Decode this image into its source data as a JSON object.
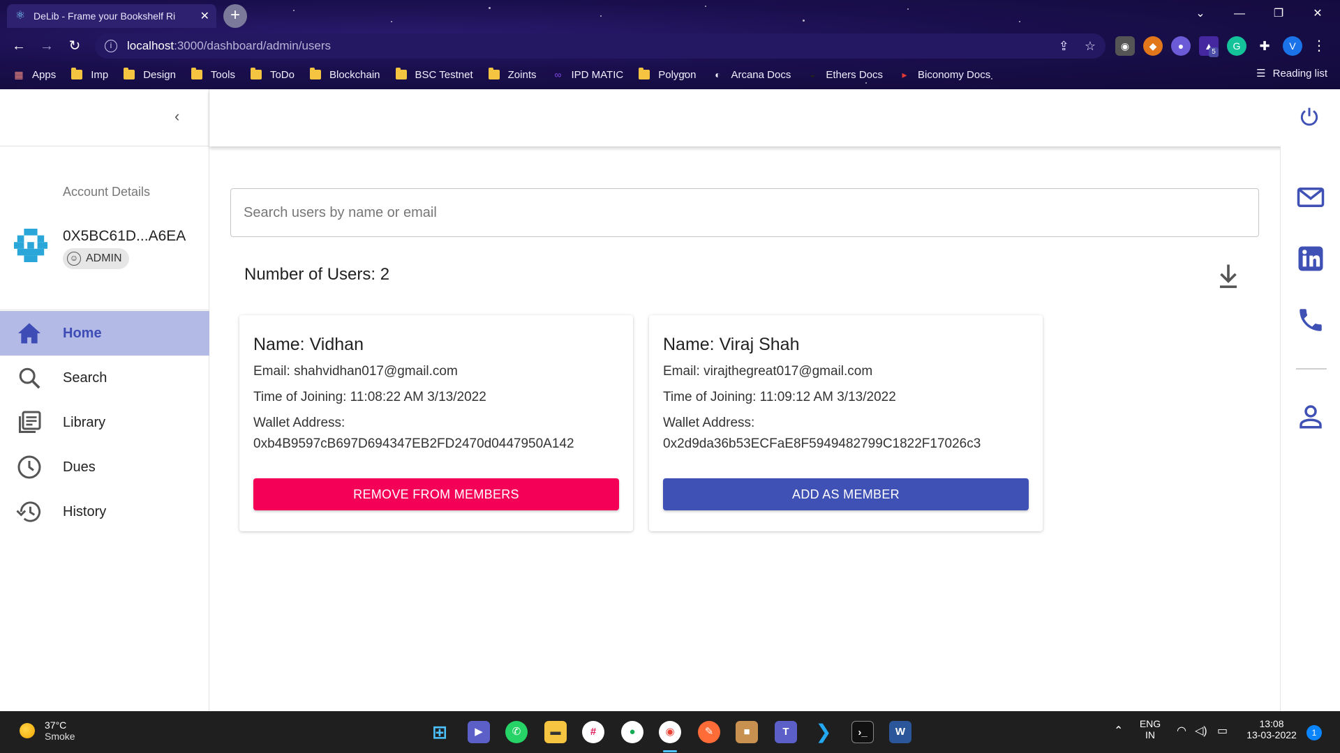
{
  "browser": {
    "tab_title": "DeLib - Frame your Bookshelf Ri",
    "url_host": "localhost",
    "url_path": ":3000/dashboard/admin/users",
    "profile_initial": "V",
    "ext_badge": "5",
    "bookmarks": [
      "Apps",
      "Imp",
      "Design",
      "Tools",
      "ToDo",
      "Blockchain",
      "BSC Testnet",
      "Zoints",
      "IPD MATIC",
      "Polygon",
      "Arcana Docs",
      "Ethers Docs",
      "Biconomy Docs"
    ],
    "reading_list": "Reading list"
  },
  "sidebar": {
    "account_title": "Account Details",
    "account_id": "0X5BC61D...A6EA",
    "role": "ADMIN",
    "nav": [
      {
        "label": "Home",
        "icon": "home-icon",
        "active": true
      },
      {
        "label": "Search",
        "icon": "search-icon",
        "active": false
      },
      {
        "label": "Library",
        "icon": "library-icon",
        "active": false
      },
      {
        "label": "Dues",
        "icon": "clock-icon",
        "active": false
      },
      {
        "label": "History",
        "icon": "history-icon",
        "active": false
      }
    ]
  },
  "main": {
    "search_placeholder": "Search users by name or email",
    "count_label": "Number of Users: 2",
    "users": [
      {
        "name": "Name: Vidhan",
        "email": "Email: shahvidhan017@gmail.com",
        "joined": "Time of Joining: 11:08:22 AM 3/13/2022",
        "wallet_label": "Wallet Address:",
        "wallet": "0xb4B9597cB697D694347EB2FD2470d0447950A142",
        "action": "REMOVE FROM MEMBERS"
      },
      {
        "name": "Name: Viraj Shah",
        "email": "Email: virajthegreat017@gmail.com",
        "joined": "Time of Joining: 11:09:12 AM 3/13/2022",
        "wallet_label": "Wallet Address:",
        "wallet": "0x2d9da36b53ECFaE8F5949482799C1822F17026c3",
        "action": "ADD AS MEMBER"
      }
    ]
  },
  "colors": {
    "primary": "#3f51b5",
    "secondary": "#f50057",
    "nav_active_bg": "#b4bae6"
  },
  "taskbar": {
    "temperature": "37°C",
    "weather": "Smoke",
    "lang": "ENG",
    "region": "IN",
    "time": "13:08",
    "date": "13-03-2022",
    "notifications": "1"
  }
}
